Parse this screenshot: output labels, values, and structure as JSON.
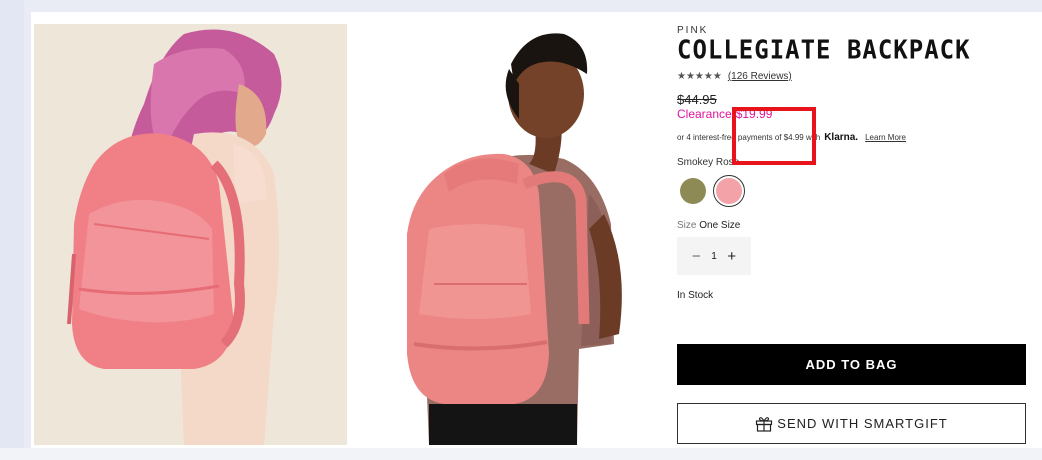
{
  "product": {
    "brand": "PINK",
    "title": "COLLEGIATE BACKPACK",
    "stars": "★★★★★",
    "reviews_link": "(126 Reviews)",
    "original_price": "$44.95",
    "clearance_label": "Clearance",
    "sale_price": "$19.99",
    "klarna_text_prefix": "or 4 interest-free payments of $4.99 with",
    "klarna_logo": "Klarna.",
    "klarna_learn_more": "Learn More",
    "color_name": "Smokey Rose",
    "swatches": [
      {
        "name": "olive",
        "color": "#8e8a56",
        "selected": false
      },
      {
        "name": "smokey-rose",
        "color": "#f3a2a8",
        "selected": true
      }
    ],
    "size_label": "Size",
    "size_value": "One Size",
    "quantity_minus": "−",
    "quantity": "1",
    "quantity_plus": "+",
    "stock_status": "In Stock",
    "add_to_bag": "ADD TO BAG",
    "send_gift": "SEND WITH SMARTGIFT"
  },
  "images": [
    {
      "icon": "model-hair-pink-backpack-photo",
      "backpack_color": "#f07f86"
    },
    {
      "icon": "model-side-backpack-photo",
      "backpack_color": "#ec8685"
    }
  ],
  "colors": {
    "sale_pink": "#e0169b",
    "highlight_red": "#e8141c",
    "button_black": "#000000"
  }
}
